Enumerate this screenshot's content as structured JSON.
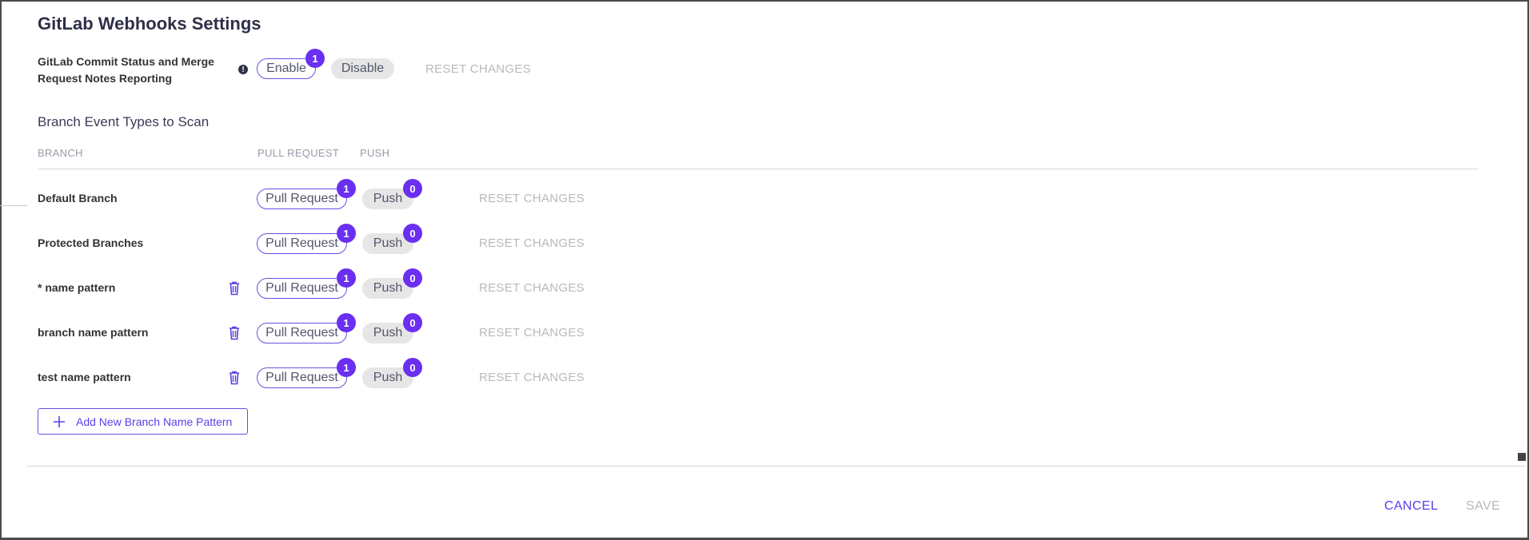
{
  "page": {
    "title": "GitLab Webhooks Settings"
  },
  "reporting": {
    "label": "GitLab Commit Status and Merge Request Notes Reporting",
    "info_icon": "info-icon",
    "enable_label": "Enable",
    "enable_badge": "1",
    "disable_label": "Disable",
    "reset_label": "RESET CHANGES"
  },
  "branch_events": {
    "section_title": "Branch Event Types to Scan",
    "columns": {
      "branch": "BRANCH",
      "pull_request": "PULL REQUEST",
      "push": "PUSH"
    },
    "rows": [
      {
        "name": "Default Branch",
        "deletable": false,
        "pr_label": "Pull Request",
        "pr_badge": "1",
        "push_label": "Push",
        "push_badge": "0",
        "reset_label": "RESET CHANGES"
      },
      {
        "name": "Protected Branches",
        "deletable": false,
        "pr_label": "Pull Request",
        "pr_badge": "1",
        "push_label": "Push",
        "push_badge": "0",
        "reset_label": "RESET CHANGES"
      },
      {
        "name": "* name pattern",
        "deletable": true,
        "pr_label": "Pull Request",
        "pr_badge": "1",
        "push_label": "Push",
        "push_badge": "0",
        "reset_label": "RESET CHANGES"
      },
      {
        "name": "branch name pattern",
        "deletable": true,
        "pr_label": "Pull Request",
        "pr_badge": "1",
        "push_label": "Push",
        "push_badge": "0",
        "reset_label": "RESET CHANGES"
      },
      {
        "name": "test name pattern",
        "deletable": true,
        "pr_label": "Pull Request",
        "pr_badge": "1",
        "push_label": "Push",
        "push_badge": "0",
        "reset_label": "RESET CHANGES"
      }
    ],
    "add_button_label": "Add New Branch Name Pattern"
  },
  "footer": {
    "cancel_label": "CANCEL",
    "save_label": "SAVE"
  },
  "colors": {
    "accent": "#6a2ff0",
    "active_border": "#6b4fe0",
    "disabled_text": "#b9b9b9",
    "chip_off": "#e6e6e6"
  }
}
